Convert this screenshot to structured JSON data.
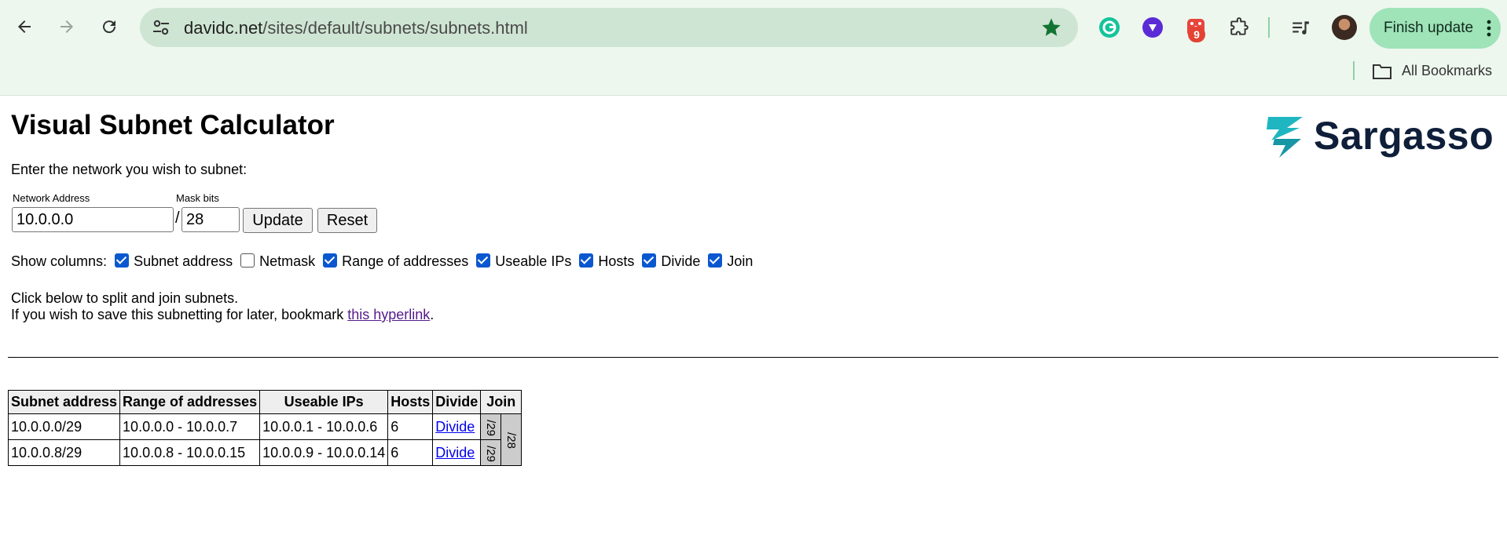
{
  "browser": {
    "url_host": "davidc.net",
    "url_path": "/sites/default/subnets/subnets.html",
    "extension_badge": "9",
    "finish_update_label": "Finish update",
    "all_bookmarks_label": "All Bookmarks",
    "accent_color": "#9fe3b9"
  },
  "page": {
    "title": "Visual Subnet Calculator",
    "logo_text": "Sargasso",
    "intro": "Enter the network you wish to subnet:",
    "form": {
      "network_label": "Network Address",
      "network_value": "10.0.0.0",
      "mask_label": "Mask bits",
      "mask_value": "28",
      "slash": "/",
      "update_label": "Update",
      "reset_label": "Reset"
    },
    "columns": {
      "label": "Show columns:",
      "options": [
        {
          "label": "Subnet address",
          "checked": true
        },
        {
          "label": "Netmask",
          "checked": false
        },
        {
          "label": "Range of addresses",
          "checked": true
        },
        {
          "label": "Useable IPs",
          "checked": true
        },
        {
          "label": "Hosts",
          "checked": true
        },
        {
          "label": "Divide",
          "checked": true
        },
        {
          "label": "Join",
          "checked": true
        }
      ]
    },
    "instructions": {
      "line1": "Click below to split and join subnets.",
      "line2_prefix": "If you wish to save this subnetting for later, bookmark ",
      "link_text": "this hyperlink",
      "line2_suffix": "."
    },
    "table": {
      "headers": [
        "Subnet address",
        "Range of addresses",
        "Useable IPs",
        "Hosts",
        "Divide",
        "Join"
      ],
      "rows": [
        {
          "subnet": "10.0.0.0/29",
          "range": "10.0.0.0 - 10.0.0.7",
          "useable": "10.0.0.1 - 10.0.0.6",
          "hosts": "6",
          "divide": "Divide",
          "join": "/29"
        },
        {
          "subnet": "10.0.0.8/29",
          "range": "10.0.0.8 - 10.0.0.15",
          "useable": "10.0.0.9 - 10.0.0.14",
          "hosts": "6",
          "divide": "Divide",
          "join": "/29"
        }
      ],
      "parent_join": "/28"
    }
  }
}
